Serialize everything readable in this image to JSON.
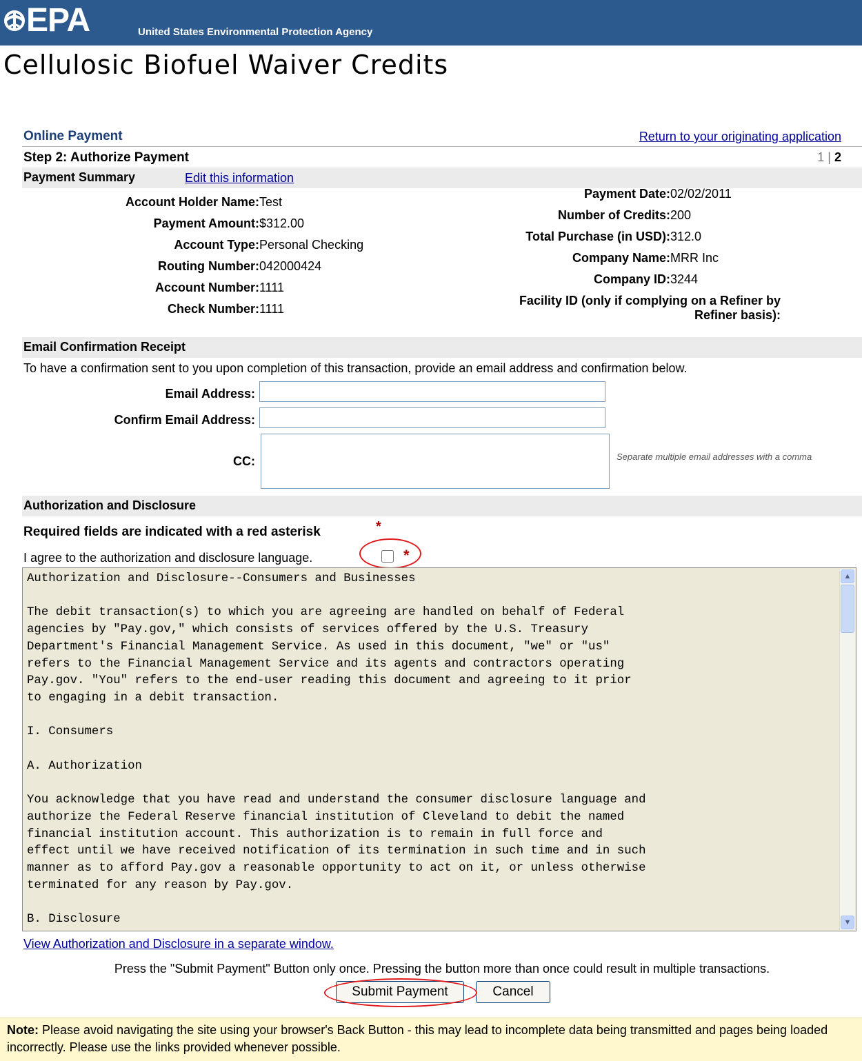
{
  "header": {
    "logo_text": "EPA",
    "agency_name": "United States Environmental Protection Agency",
    "color": "#2c5a8e"
  },
  "page_title": "Cellulosic Biofuel Waiver Credits",
  "online_payment": {
    "label": "Online Payment",
    "return_link": "Return to your originating application"
  },
  "step": {
    "label": "Step 2: Authorize Payment",
    "step_1": "1",
    "separator": " | ",
    "step_2": "2"
  },
  "payment_summary": {
    "title": "Payment Summary",
    "edit_link": "Edit this information",
    "left": [
      {
        "label": "Account Holder Name:",
        "value": "Test"
      },
      {
        "label": "Payment Amount:",
        "value": "$312.00"
      },
      {
        "label": "Account Type:",
        "value": "Personal Checking"
      },
      {
        "label": "Routing Number:",
        "value": "042000424"
      },
      {
        "label": "Account Number:",
        "value": "1111"
      },
      {
        "label": "Check Number:",
        "value": "1111"
      }
    ],
    "right": [
      {
        "label": "Payment Date:",
        "value": "02/02/2011"
      },
      {
        "label": "Number of Credits:",
        "value": "200"
      },
      {
        "label": "Total Purchase (in USD):",
        "value": "312.0"
      },
      {
        "label": "Company Name:",
        "value": "MRR Inc"
      },
      {
        "label": "Company ID:",
        "value": "3244"
      },
      {
        "label": "Facility ID (only if complying on a Refiner by",
        "label2": "Refiner basis):",
        "value": ""
      }
    ]
  },
  "email": {
    "title": "Email Confirmation Receipt",
    "intro": "To have a confirmation sent to you upon completion of this transaction, provide an email address and confirmation below.",
    "email_label": "Email Address:",
    "email_value": "",
    "confirm_label": "Confirm Email Address:",
    "confirm_value": "",
    "cc_label": "CC:",
    "cc_value": "",
    "cc_hint": "Separate multiple email addresses with a comma"
  },
  "authorization": {
    "title": "Authorization and Disclosure",
    "required_note": "Required fields are indicated with a red asterisk",
    "asterisk": "*",
    "agree_text": "I agree to the authorization and disclosure language.",
    "agree_checked": false,
    "disclosure_text": "Authorization and Disclosure--Consumers and Businesses\n\nThe debit transaction(s) to which you are agreeing are handled on behalf of Federal\nagencies by \"Pay.gov,\" which consists of services offered by the U.S. Treasury\nDepartment's Financial Management Service. As used in this document, \"we\" or \"us\"\nrefers to the Financial Management Service and its agents and contractors operating\nPay.gov. \"You\" refers to the end-user reading this document and agreeing to it prior\nto engaging in a debit transaction.\n\nI. Consumers\n\nA. Authorization\n\nYou acknowledge that you have read and understand the consumer disclosure language and\nauthorize the Federal Reserve financial institution of Cleveland to debit the named\nfinancial institution account. This authorization is to remain in full force and\neffect until we have received notification of its termination in such time and in such\nmanner as to afford Pay.gov a reasonable opportunity to act on it, or unless otherwise\nterminated for any reason by Pay.gov.\n\nB. Disclosure",
    "view_link": "View Authorization and Disclosure in a separate window."
  },
  "submit": {
    "press_note": "Press the \"Submit Payment\" Button only once. Pressing the button more than once could result in multiple transactions.",
    "submit_label": "Submit Payment",
    "cancel_label": "Cancel"
  },
  "note": {
    "label": "Note:",
    "text": " Please avoid navigating the site using your browser's Back Button - this may lead to incomplete data being transmitted and pages being loaded incorrectly. Please use the links provided whenever possible."
  }
}
